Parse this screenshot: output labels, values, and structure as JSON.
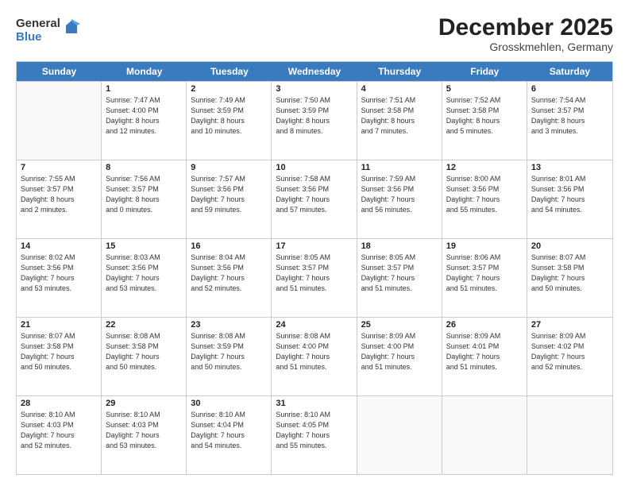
{
  "logo": {
    "general": "General",
    "blue": "Blue"
  },
  "title": "December 2025",
  "location": "Grosskmehlen, Germany",
  "days": [
    "Sunday",
    "Monday",
    "Tuesday",
    "Wednesday",
    "Thursday",
    "Friday",
    "Saturday"
  ],
  "weeks": [
    [
      {
        "day": "",
        "info": ""
      },
      {
        "day": "1",
        "info": "Sunrise: 7:47 AM\nSunset: 4:00 PM\nDaylight: 8 hours\nand 12 minutes."
      },
      {
        "day": "2",
        "info": "Sunrise: 7:49 AM\nSunset: 3:59 PM\nDaylight: 8 hours\nand 10 minutes."
      },
      {
        "day": "3",
        "info": "Sunrise: 7:50 AM\nSunset: 3:59 PM\nDaylight: 8 hours\nand 8 minutes."
      },
      {
        "day": "4",
        "info": "Sunrise: 7:51 AM\nSunset: 3:58 PM\nDaylight: 8 hours\nand 7 minutes."
      },
      {
        "day": "5",
        "info": "Sunrise: 7:52 AM\nSunset: 3:58 PM\nDaylight: 8 hours\nand 5 minutes."
      },
      {
        "day": "6",
        "info": "Sunrise: 7:54 AM\nSunset: 3:57 PM\nDaylight: 8 hours\nand 3 minutes."
      }
    ],
    [
      {
        "day": "7",
        "info": "Sunrise: 7:55 AM\nSunset: 3:57 PM\nDaylight: 8 hours\nand 2 minutes."
      },
      {
        "day": "8",
        "info": "Sunrise: 7:56 AM\nSunset: 3:57 PM\nDaylight: 8 hours\nand 0 minutes."
      },
      {
        "day": "9",
        "info": "Sunrise: 7:57 AM\nSunset: 3:56 PM\nDaylight: 7 hours\nand 59 minutes."
      },
      {
        "day": "10",
        "info": "Sunrise: 7:58 AM\nSunset: 3:56 PM\nDaylight: 7 hours\nand 57 minutes."
      },
      {
        "day": "11",
        "info": "Sunrise: 7:59 AM\nSunset: 3:56 PM\nDaylight: 7 hours\nand 56 minutes."
      },
      {
        "day": "12",
        "info": "Sunrise: 8:00 AM\nSunset: 3:56 PM\nDaylight: 7 hours\nand 55 minutes."
      },
      {
        "day": "13",
        "info": "Sunrise: 8:01 AM\nSunset: 3:56 PM\nDaylight: 7 hours\nand 54 minutes."
      }
    ],
    [
      {
        "day": "14",
        "info": "Sunrise: 8:02 AM\nSunset: 3:56 PM\nDaylight: 7 hours\nand 53 minutes."
      },
      {
        "day": "15",
        "info": "Sunrise: 8:03 AM\nSunset: 3:56 PM\nDaylight: 7 hours\nand 53 minutes."
      },
      {
        "day": "16",
        "info": "Sunrise: 8:04 AM\nSunset: 3:56 PM\nDaylight: 7 hours\nand 52 minutes."
      },
      {
        "day": "17",
        "info": "Sunrise: 8:05 AM\nSunset: 3:57 PM\nDaylight: 7 hours\nand 51 minutes."
      },
      {
        "day": "18",
        "info": "Sunrise: 8:05 AM\nSunset: 3:57 PM\nDaylight: 7 hours\nand 51 minutes."
      },
      {
        "day": "19",
        "info": "Sunrise: 8:06 AM\nSunset: 3:57 PM\nDaylight: 7 hours\nand 51 minutes."
      },
      {
        "day": "20",
        "info": "Sunrise: 8:07 AM\nSunset: 3:58 PM\nDaylight: 7 hours\nand 50 minutes."
      }
    ],
    [
      {
        "day": "21",
        "info": "Sunrise: 8:07 AM\nSunset: 3:58 PM\nDaylight: 7 hours\nand 50 minutes."
      },
      {
        "day": "22",
        "info": "Sunrise: 8:08 AM\nSunset: 3:58 PM\nDaylight: 7 hours\nand 50 minutes."
      },
      {
        "day": "23",
        "info": "Sunrise: 8:08 AM\nSunset: 3:59 PM\nDaylight: 7 hours\nand 50 minutes."
      },
      {
        "day": "24",
        "info": "Sunrise: 8:08 AM\nSunset: 4:00 PM\nDaylight: 7 hours\nand 51 minutes."
      },
      {
        "day": "25",
        "info": "Sunrise: 8:09 AM\nSunset: 4:00 PM\nDaylight: 7 hours\nand 51 minutes."
      },
      {
        "day": "26",
        "info": "Sunrise: 8:09 AM\nSunset: 4:01 PM\nDaylight: 7 hours\nand 51 minutes."
      },
      {
        "day": "27",
        "info": "Sunrise: 8:09 AM\nSunset: 4:02 PM\nDaylight: 7 hours\nand 52 minutes."
      }
    ],
    [
      {
        "day": "28",
        "info": "Sunrise: 8:10 AM\nSunset: 4:03 PM\nDaylight: 7 hours\nand 52 minutes."
      },
      {
        "day": "29",
        "info": "Sunrise: 8:10 AM\nSunset: 4:03 PM\nDaylight: 7 hours\nand 53 minutes."
      },
      {
        "day": "30",
        "info": "Sunrise: 8:10 AM\nSunset: 4:04 PM\nDaylight: 7 hours\nand 54 minutes."
      },
      {
        "day": "31",
        "info": "Sunrise: 8:10 AM\nSunset: 4:05 PM\nDaylight: 7 hours\nand 55 minutes."
      },
      {
        "day": "",
        "info": ""
      },
      {
        "day": "",
        "info": ""
      },
      {
        "day": "",
        "info": ""
      }
    ]
  ]
}
